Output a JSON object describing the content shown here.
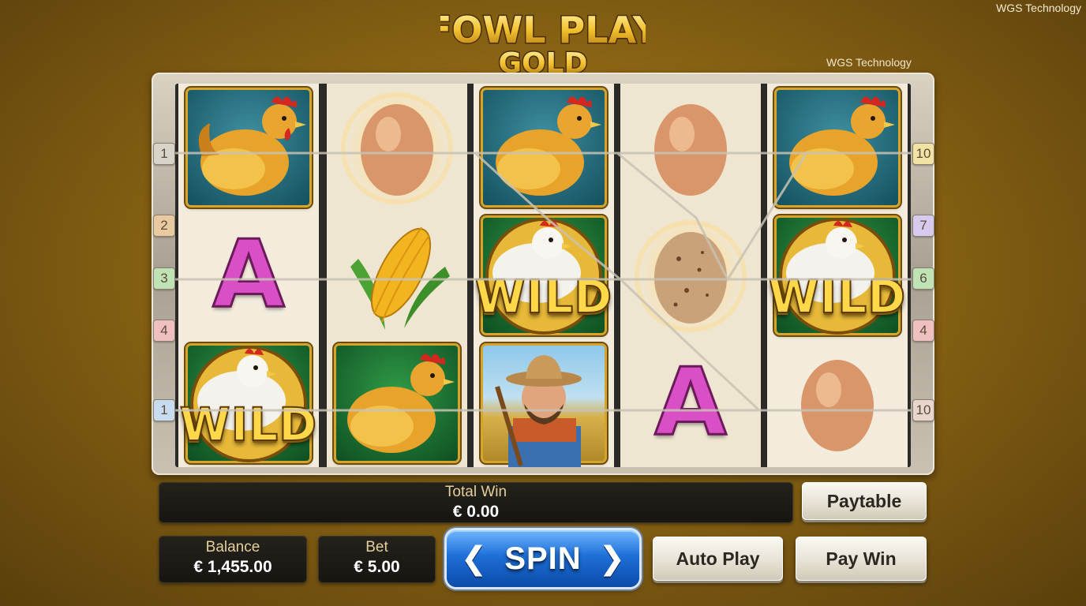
{
  "credits": {
    "top_right": "WGS Technology",
    "below_logo": "WGS Technology"
  },
  "logo": {
    "line1": "FOWL PLAY",
    "line2": "GOLD"
  },
  "reels": [
    [
      "hen",
      "letter-a",
      "wild"
    ],
    [
      "egg-glow",
      "corn",
      "hen"
    ],
    [
      "hen",
      "wild",
      "farmer"
    ],
    [
      "egg",
      "speckled-egg-glow",
      "letter-a"
    ],
    [
      "hen",
      "wild",
      "egg"
    ]
  ],
  "symbol_text": {
    "wild": "WILD",
    "letter_a": "A"
  },
  "paylines": {
    "left": [
      "1",
      "2",
      "3",
      "4",
      "1"
    ],
    "right": [
      "10",
      "7",
      "6",
      "4",
      "10"
    ]
  },
  "total_win": {
    "label": "Total Win",
    "value": "€ 0.00"
  },
  "balance": {
    "label": "Balance",
    "value": "€ 1,455.00"
  },
  "bet": {
    "label": "Bet",
    "value": "€ 5.00"
  },
  "buttons": {
    "spin": "SPIN",
    "paytable": "Paytable",
    "auto_play": "Auto Play",
    "pay_win": "Pay Win"
  },
  "colors": {
    "background": "#8a6414",
    "spin_button": "#1e6fd8",
    "letter_a": "#d94fc5",
    "wild_gold": "#ffd84a"
  }
}
